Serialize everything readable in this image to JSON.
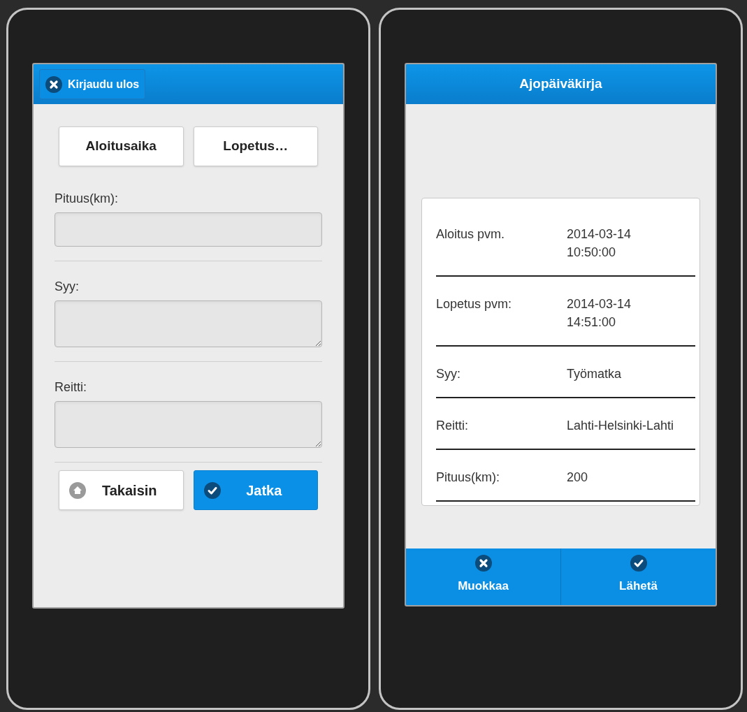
{
  "left_screen": {
    "header": {
      "logout_button": "Kirjaudu ulos"
    },
    "time_buttons": [
      "Aloitusaika",
      "Lopetus…"
    ],
    "fields": [
      {
        "label": "Pituus(km):",
        "kind": "input"
      },
      {
        "label": "Syy:",
        "kind": "textarea"
      },
      {
        "label": "Reitti:",
        "kind": "textarea"
      }
    ],
    "buttons": [
      {
        "label": "Takaisin",
        "kind": "back"
      },
      {
        "label": "Jatka",
        "kind": "continue"
      }
    ]
  },
  "right_screen": {
    "title": "Ajopäiväkirja",
    "rows": [
      {
        "label": "Aloitus pvm.",
        "value": [
          "2014-03-14",
          "10:50:00"
        ]
      },
      {
        "label": "Lopetus pvm:",
        "value": [
          "2014-03-14",
          "14:51:00"
        ]
      },
      {
        "label": "Syy:",
        "value": [
          "Työmatka"
        ]
      },
      {
        "label": "Reitti:",
        "value": [
          "Lahti-Helsinki-Lahti"
        ]
      },
      {
        "label": "Pituus(km):",
        "value": [
          "200"
        ]
      }
    ],
    "footer": [
      {
        "label": "Muokkaa",
        "kind": "edit"
      },
      {
        "label": "Lähetä",
        "kind": "send"
      }
    ]
  }
}
